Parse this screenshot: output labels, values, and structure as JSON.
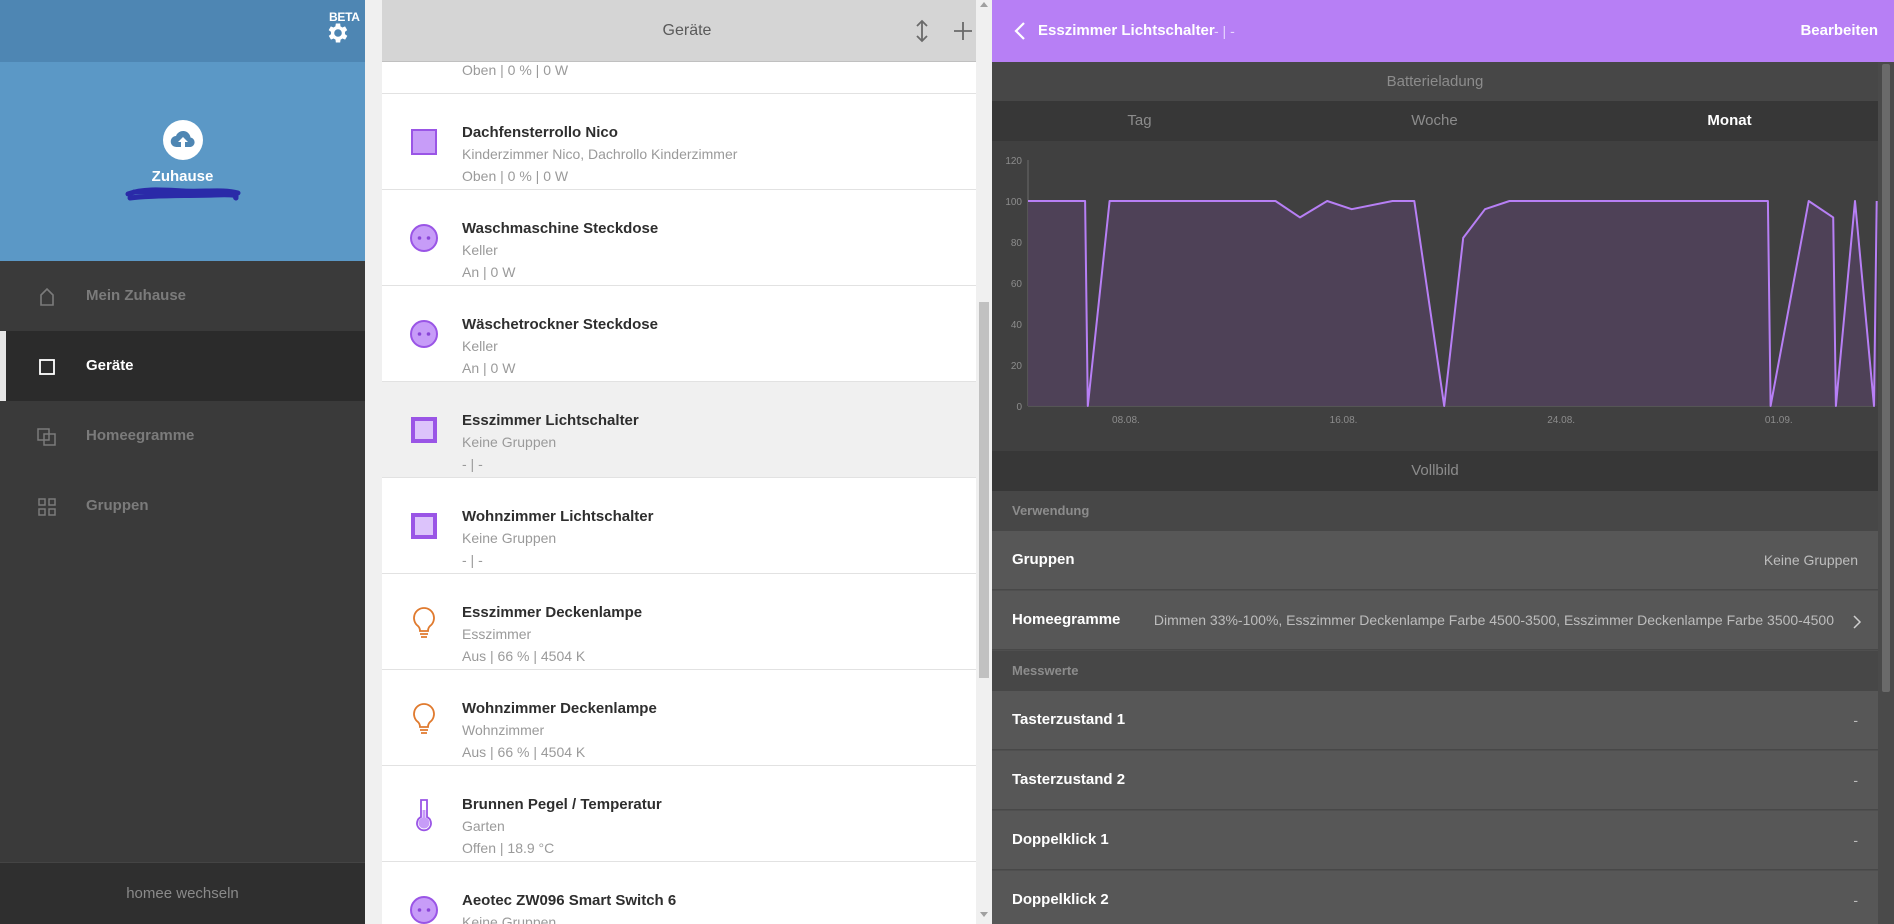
{
  "sidebar": {
    "beta_label": "BETA",
    "home_name": "Zuhause",
    "nav": [
      {
        "label": "Mein Zuhause",
        "icon": "house-icon",
        "active": false
      },
      {
        "label": "Geräte",
        "icon": "device-square-icon",
        "active": true
      },
      {
        "label": "Homeegramme",
        "icon": "homeegram-icon",
        "active": false
      },
      {
        "label": "Gruppen",
        "icon": "groups-icon",
        "active": false
      }
    ],
    "switch_label": "homee wechseln"
  },
  "device_list": {
    "title": "Geräte",
    "partial_first_status": "Oben | 0 % | 0 W",
    "devices": [
      {
        "name": "Dachfensterrollo Nico",
        "room": "Kinderzimmer Nico, Dachrollo Kinderzimmer",
        "status": "Oben | 0 % | 0 W",
        "icon": "shutter-icon",
        "selected": false
      },
      {
        "name": "Waschmaschine Steckdose",
        "room": "Keller",
        "status": "An | 0 W",
        "icon": "socket-icon",
        "selected": false
      },
      {
        "name": "Wäschetrockner Steckdose",
        "room": "Keller",
        "status": "An | 0 W",
        "icon": "socket-icon",
        "selected": false
      },
      {
        "name": "Esszimmer Lichtschalter",
        "room": "Keine Gruppen",
        "status": "- | -",
        "icon": "switch-icon",
        "selected": true
      },
      {
        "name": "Wohnzimmer Lichtschalter",
        "room": "Keine Gruppen",
        "status": "- | -",
        "icon": "switch-icon",
        "selected": false
      },
      {
        "name": "Esszimmer Deckenlampe",
        "room": "Esszimmer",
        "status": "Aus | 66 % | 4504 K",
        "icon": "bulb-icon",
        "selected": false
      },
      {
        "name": "Wohnzimmer Deckenlampe",
        "room": "Wohnzimmer",
        "status": "Aus | 66 % | 4504 K",
        "icon": "bulb-icon",
        "selected": false
      },
      {
        "name": "Brunnen Pegel / Temperatur",
        "room": "Garten",
        "status": "Offen | 18.9 °C",
        "icon": "thermometer-icon",
        "selected": false
      },
      {
        "name": "Aeotec ZW096 Smart Switch 6",
        "room": "Keine Gruppen",
        "status": "",
        "icon": "socket-icon",
        "selected": false
      }
    ]
  },
  "detail": {
    "title": "Esszimmer Lichtschalter",
    "status": "- | -",
    "edit_label": "Bearbeiten",
    "chart_title": "Batterieladung",
    "tabs": [
      {
        "label": "Tag",
        "active": false
      },
      {
        "label": "Woche",
        "active": false
      },
      {
        "label": "Monat",
        "active": true
      }
    ],
    "fullscreen_label": "Vollbild",
    "usage_section": "Verwendung",
    "groups_label": "Gruppen",
    "groups_value": "Keine Gruppen",
    "homeegrams_label": "Homeegramme",
    "homeegrams_value": "Dimmen 33%-100%, Esszimmer Deckenlampe Farbe 4500-3500, Esszimmer Deckenlampe Farbe 3500-4500",
    "measure_section": "Messwerte",
    "measurements": [
      {
        "label": "Tasterzustand 1",
        "value": "-"
      },
      {
        "label": "Tasterzustand 2",
        "value": "-"
      },
      {
        "label": "Doppelklick 1",
        "value": "-"
      },
      {
        "label": "Doppelklick 2",
        "value": "-"
      }
    ]
  },
  "colors": {
    "accent_purple": "#b77ff5",
    "sidebar_blue": "#5b98c6",
    "bulb_orange": "#e07a2e",
    "chart_line": "#b77ff5",
    "chart_fill": "#4f4159"
  },
  "chart_data": {
    "type": "area",
    "title": "Batterieladung",
    "xlabel": "",
    "ylabel": "",
    "ylim": [
      0,
      120
    ],
    "y_ticks": [
      0,
      20,
      40,
      60,
      80,
      100,
      120
    ],
    "x_tick_labels": [
      "08.08.",
      "16.08.",
      "24.08.",
      "01.09."
    ],
    "x_tick_days": [
      8,
      16,
      24,
      32
    ],
    "x_range_days": [
      4.4,
      35.5
    ],
    "grid": false,
    "series": [
      {
        "x": [
          4.4,
          6.5,
          6.6,
          7.4,
          9.2,
          13.5,
          14.4,
          15.4,
          16.3,
          17.8,
          18.6,
          19.7,
          20.4,
          21.2,
          22.1,
          26.0,
          30.6,
          31.6,
          31.7,
          33.1,
          34.0,
          34.1,
          34.8,
          35.5,
          35.6
        ],
        "y": [
          100,
          100,
          0,
          100,
          100,
          100,
          92,
          100,
          96,
          100,
          100,
          0,
          82,
          96,
          100,
          100,
          100,
          100,
          0,
          100,
          92,
          0,
          100,
          0,
          100
        ]
      }
    ]
  }
}
